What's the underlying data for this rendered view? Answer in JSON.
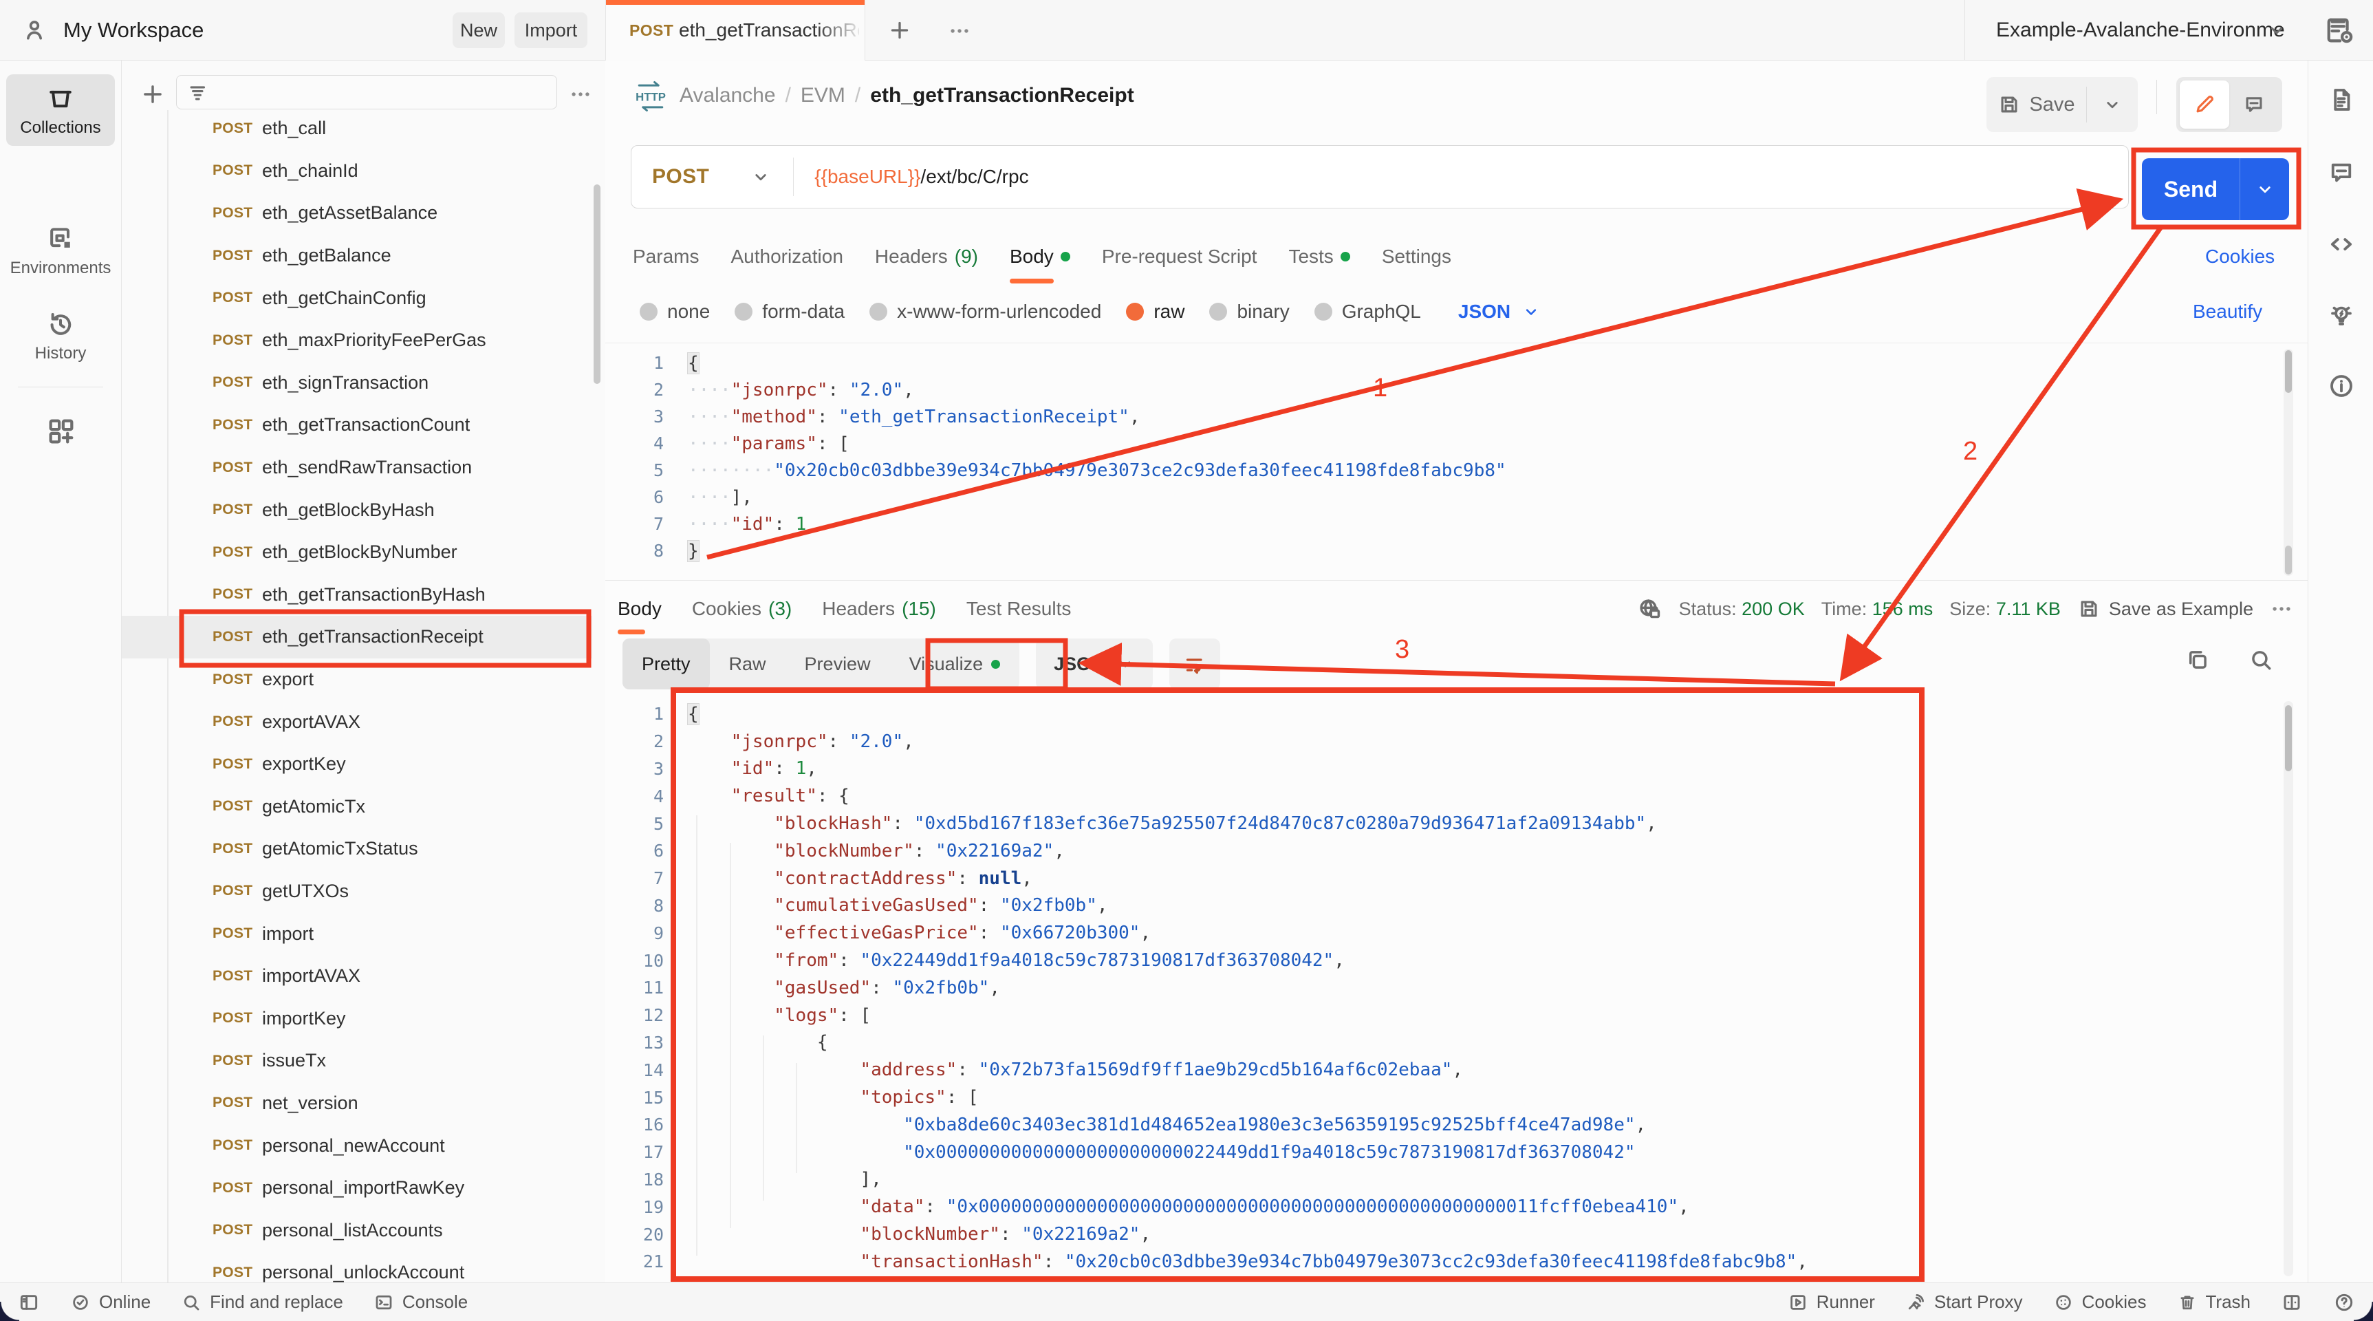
{
  "header": {
    "workspace": "My Workspace",
    "new_label": "New",
    "import_label": "Import",
    "tab": {
      "method": "POST",
      "title": "eth_getTransactionRece"
    },
    "environment": "Example-Avalanche-Environme"
  },
  "breadcrumb": {
    "part1": "Avalanche",
    "part2": "EVM",
    "current": "eth_getTransactionReceipt",
    "save_label": "Save"
  },
  "url_row": {
    "method": "POST",
    "url_var": "{{baseURL}}",
    "url_path": "/ext/bc/C/rpc",
    "send_label": "Send"
  },
  "request_tabs": {
    "items": [
      {
        "label": "Params"
      },
      {
        "label": "Authorization"
      },
      {
        "label": "Headers",
        "count": "(9)"
      },
      {
        "label": "Body"
      },
      {
        "label": "Pre-request Script"
      },
      {
        "label": "Tests"
      },
      {
        "label": "Settings"
      }
    ],
    "cookies_link": "Cookies"
  },
  "body_types": {
    "options": [
      "none",
      "form-data",
      "x-www-form-urlencoded",
      "raw",
      "binary",
      "GraphQL"
    ],
    "selected": "raw",
    "language": "JSON",
    "beautify_link": "Beautify"
  },
  "request_editor": {
    "lines": [
      [
        [
          "brh",
          "{"
        ]
      ],
      [
        [
          "ws",
          "····"
        ],
        [
          "key",
          "\"jsonrpc\""
        ],
        [
          "pun",
          ": "
        ],
        [
          "str",
          "\"2.0\""
        ],
        [
          "pun",
          ","
        ]
      ],
      [
        [
          "ws",
          "····"
        ],
        [
          "key",
          "\"method\""
        ],
        [
          "pun",
          ": "
        ],
        [
          "str",
          "\"eth_getTransactionReceipt\""
        ],
        [
          "pun",
          ","
        ]
      ],
      [
        [
          "ws",
          "····"
        ],
        [
          "key",
          "\"params\""
        ],
        [
          "pun",
          ": ["
        ]
      ],
      [
        [
          "ws",
          "········"
        ],
        [
          "str",
          "\"0x20cb0c03dbbe39e934c7bb04979e3073ce2c93defa30feec41198fde8fabc9b8\""
        ]
      ],
      [
        [
          "ws",
          "····"
        ],
        [
          "pun",
          "],"
        ]
      ],
      [
        [
          "ws",
          "····"
        ],
        [
          "key",
          "\"id\""
        ],
        [
          "pun",
          ": "
        ],
        [
          "num",
          "1"
        ]
      ],
      [
        [
          "brh",
          "}"
        ]
      ]
    ]
  },
  "response_meta": {
    "tab_body": "Body",
    "tab_cookies": "Cookies",
    "cookies_count": "(3)",
    "tab_headers": "Headers",
    "headers_count": "(15)",
    "tab_tests": "Test Results",
    "status_label": "Status:",
    "status_value": "200 OK",
    "time_label": "Time:",
    "time_value": "156 ms",
    "size_label": "Size:",
    "size_value": "7.11 KB",
    "save_as_example": "Save as Example"
  },
  "response_format": {
    "views": [
      "Pretty",
      "Raw",
      "Preview",
      "Visualize"
    ],
    "active": "Pretty",
    "language": "JSON"
  },
  "response_editor": {
    "lines": [
      [
        [
          "brh",
          "{"
        ]
      ],
      [
        [
          "ws",
          "    "
        ],
        [
          "key",
          "\"jsonrpc\""
        ],
        [
          "pun",
          ": "
        ],
        [
          "str",
          "\"2.0\""
        ],
        [
          "pun",
          ","
        ]
      ],
      [
        [
          "ws",
          "    "
        ],
        [
          "key",
          "\"id\""
        ],
        [
          "pun",
          ": "
        ],
        [
          "num",
          "1"
        ],
        [
          "pun",
          ","
        ]
      ],
      [
        [
          "ws",
          "    "
        ],
        [
          "key",
          "\"result\""
        ],
        [
          "pun",
          ": {"
        ]
      ],
      [
        [
          "ws",
          "        "
        ],
        [
          "key",
          "\"blockHash\""
        ],
        [
          "pun",
          ": "
        ],
        [
          "str",
          "\"0xd5bd167f183efc36e75a925507f24d8470c87c0280a79d936471af2a09134abb\""
        ],
        [
          "pun",
          ","
        ]
      ],
      [
        [
          "ws",
          "        "
        ],
        [
          "key",
          "\"blockNumber\""
        ],
        [
          "pun",
          ": "
        ],
        [
          "str",
          "\"0x22169a2\""
        ],
        [
          "pun",
          ","
        ]
      ],
      [
        [
          "ws",
          "        "
        ],
        [
          "key",
          "\"contractAddress\""
        ],
        [
          "pun",
          ": "
        ],
        [
          "nul",
          "null"
        ],
        [
          "pun",
          ","
        ]
      ],
      [
        [
          "ws",
          "        "
        ],
        [
          "key",
          "\"cumulativeGasUsed\""
        ],
        [
          "pun",
          ": "
        ],
        [
          "str",
          "\"0x2fb0b\""
        ],
        [
          "pun",
          ","
        ]
      ],
      [
        [
          "ws",
          "        "
        ],
        [
          "key",
          "\"effectiveGasPrice\""
        ],
        [
          "pun",
          ": "
        ],
        [
          "str",
          "\"0x66720b300\""
        ],
        [
          "pun",
          ","
        ]
      ],
      [
        [
          "ws",
          "        "
        ],
        [
          "key",
          "\"from\""
        ],
        [
          "pun",
          ": "
        ],
        [
          "str",
          "\"0x22449dd1f9a4018c59c7873190817df363708042\""
        ],
        [
          "pun",
          ","
        ]
      ],
      [
        [
          "ws",
          "        "
        ],
        [
          "key",
          "\"gasUsed\""
        ],
        [
          "pun",
          ": "
        ],
        [
          "str",
          "\"0x2fb0b\""
        ],
        [
          "pun",
          ","
        ]
      ],
      [
        [
          "ws",
          "        "
        ],
        [
          "key",
          "\"logs\""
        ],
        [
          "pun",
          ": ["
        ]
      ],
      [
        [
          "ws",
          "            "
        ],
        [
          "pun",
          "{"
        ]
      ],
      [
        [
          "ws",
          "                "
        ],
        [
          "key",
          "\"address\""
        ],
        [
          "pun",
          ": "
        ],
        [
          "str",
          "\"0x72b73fa1569df9ff1ae9b29cd5b164af6c02ebaa\""
        ],
        [
          "pun",
          ","
        ]
      ],
      [
        [
          "ws",
          "                "
        ],
        [
          "key",
          "\"topics\""
        ],
        [
          "pun",
          ": ["
        ]
      ],
      [
        [
          "ws",
          "                    "
        ],
        [
          "str",
          "\"0xba8de60c3403ec381d1d484652ea1980e3c3e56359195c92525bff4ce47ad98e\""
        ],
        [
          "pun",
          ","
        ]
      ],
      [
        [
          "ws",
          "                    "
        ],
        [
          "str",
          "\"0x00000000000000000000000022449dd1f9a4018c59c7873190817df363708042\""
        ]
      ],
      [
        [
          "ws",
          "                "
        ],
        [
          "pun",
          "],"
        ]
      ],
      [
        [
          "ws",
          "                "
        ],
        [
          "key",
          "\"data\""
        ],
        [
          "pun",
          ": "
        ],
        [
          "str",
          "\"0x0000000000000000000000000000000000000000000000000011fcff0ebea410\""
        ],
        [
          "pun",
          ","
        ]
      ],
      [
        [
          "ws",
          "                "
        ],
        [
          "key",
          "\"blockNumber\""
        ],
        [
          "pun",
          ": "
        ],
        [
          "str",
          "\"0x22169a2\""
        ],
        [
          "pun",
          ","
        ]
      ],
      [
        [
          "ws",
          "                "
        ],
        [
          "key",
          "\"transactionHash\""
        ],
        [
          "pun",
          ": "
        ],
        [
          "str",
          "\"0x20cb0c03dbbe39e934c7bb04979e3073cc2c93defa30feec41198fde8fabc9b8\""
        ],
        [
          "pun",
          ","
        ]
      ]
    ]
  },
  "sidebar": {
    "rail": {
      "collections": "Collections",
      "environments": "Environments",
      "history": "History"
    },
    "items": [
      {
        "method": "POST",
        "name": "eth_call"
      },
      {
        "method": "POST",
        "name": "eth_chainId"
      },
      {
        "method": "POST",
        "name": "eth_getAssetBalance"
      },
      {
        "method": "POST",
        "name": "eth_getBalance"
      },
      {
        "method": "POST",
        "name": "eth_getChainConfig"
      },
      {
        "method": "POST",
        "name": "eth_maxPriorityFeePerGas"
      },
      {
        "method": "POST",
        "name": "eth_signTransaction"
      },
      {
        "method": "POST",
        "name": "eth_getTransactionCount"
      },
      {
        "method": "POST",
        "name": "eth_sendRawTransaction"
      },
      {
        "method": "POST",
        "name": "eth_getBlockByHash"
      },
      {
        "method": "POST",
        "name": "eth_getBlockByNumber"
      },
      {
        "method": "POST",
        "name": "eth_getTransactionByHash"
      },
      {
        "method": "POST",
        "name": "eth_getTransactionReceipt"
      },
      {
        "method": "POST",
        "name": "export"
      },
      {
        "method": "POST",
        "name": "exportAVAX"
      },
      {
        "method": "POST",
        "name": "exportKey"
      },
      {
        "method": "POST",
        "name": "getAtomicTx"
      },
      {
        "method": "POST",
        "name": "getAtomicTxStatus"
      },
      {
        "method": "POST",
        "name": "getUTXOs"
      },
      {
        "method": "POST",
        "name": "import"
      },
      {
        "method": "POST",
        "name": "importAVAX"
      },
      {
        "method": "POST",
        "name": "importKey"
      },
      {
        "method": "POST",
        "name": "issueTx"
      },
      {
        "method": "POST",
        "name": "net_version"
      },
      {
        "method": "POST",
        "name": "personal_newAccount"
      },
      {
        "method": "POST",
        "name": "personal_importRawKey"
      },
      {
        "method": "POST",
        "name": "personal_listAccounts"
      },
      {
        "method": "POST",
        "name": "personal_unlockAccount"
      }
    ],
    "selected": "eth_getTransactionReceipt"
  },
  "statusbar": {
    "online": "Online",
    "find": "Find and replace",
    "console": "Console",
    "runner": "Runner",
    "proxy": "Start Proxy",
    "cookies": "Cookies",
    "trash": "Trash"
  },
  "annotations": {
    "labels": [
      "1",
      "2",
      "3"
    ],
    "color": "#ee3b23"
  }
}
